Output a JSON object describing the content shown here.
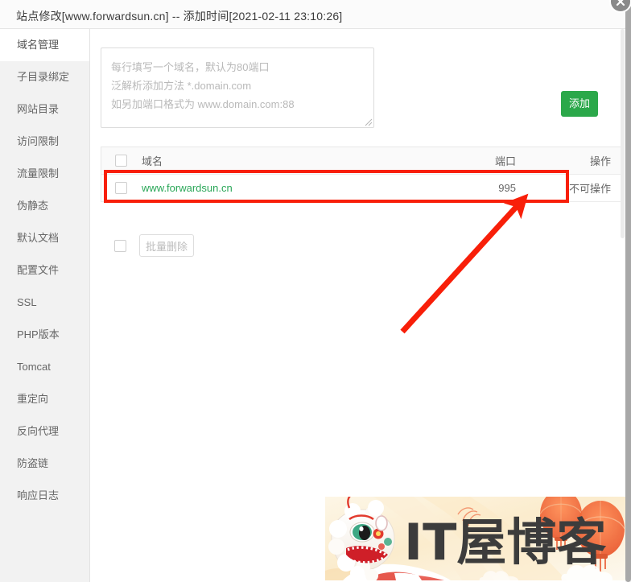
{
  "window": {
    "title": "站点修改[www.forwardsun.cn] -- 添加时间[2021-02-11 23:10:26]",
    "close_label": "×"
  },
  "sidebar": {
    "items": [
      {
        "label": "域名管理",
        "active": true
      },
      {
        "label": "子目录绑定",
        "active": false
      },
      {
        "label": "网站目录",
        "active": false
      },
      {
        "label": "访问限制",
        "active": false
      },
      {
        "label": "流量限制",
        "active": false
      },
      {
        "label": "伪静态",
        "active": false
      },
      {
        "label": "默认文档",
        "active": false
      },
      {
        "label": "配置文件",
        "active": false
      },
      {
        "label": "SSL",
        "active": false
      },
      {
        "label": "PHP版本",
        "active": false
      },
      {
        "label": "Tomcat",
        "active": false
      },
      {
        "label": "重定向",
        "active": false
      },
      {
        "label": "反向代理",
        "active": false
      },
      {
        "label": "防盗链",
        "active": false
      },
      {
        "label": "响应日志",
        "active": false
      }
    ]
  },
  "add_panel": {
    "textarea_value": "",
    "textarea_placeholder": "每行填写一个域名，默认为80端口\n泛解析添加方法 *.domain.com\n如另加端口格式为 www.domain.com:88",
    "add_button_label": "添加"
  },
  "table": {
    "headers": {
      "domain": "域名",
      "port": "端口",
      "operation": "操作"
    },
    "rows": [
      {
        "domain": "www.forwardsun.cn",
        "port": "995",
        "operation": "不可操作"
      }
    ],
    "batch_delete_label": "批量删除"
  },
  "annotation": {
    "highlight_color": "#f81f09",
    "arrow_color": "#f81f09",
    "arrow_from": "500,410",
    "arrow_to": "648,248"
  },
  "watermark": {
    "text": "IT屋博客"
  },
  "colors": {
    "accent_green": "#2ba84a",
    "link_green": "#2aa758",
    "sidebar_bg": "#f2f2f2",
    "header_bg": "#fafafa"
  }
}
